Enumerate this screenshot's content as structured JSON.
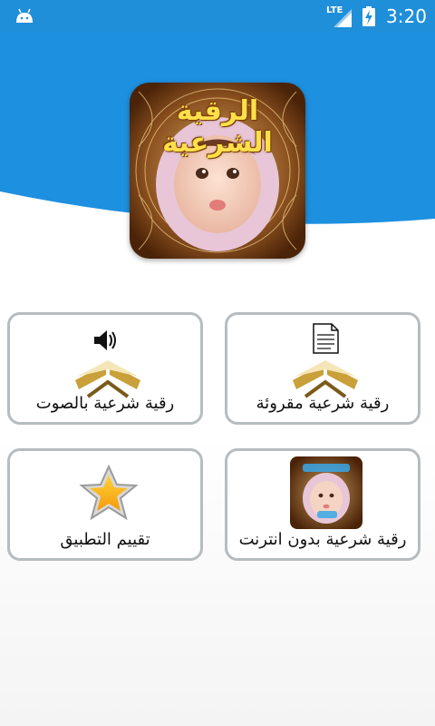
{
  "status_bar": {
    "network": "LTE",
    "time": "3:20"
  },
  "app": {
    "logo_title": "الرقية الشرعية"
  },
  "menu": {
    "written": "رقية شرعية مقروئة",
    "audio": "رقية شرعية بالصوت",
    "offline": "رقية شرعية بدون انترنت",
    "rate": "تقييم التطبيق"
  },
  "icons": {
    "written": "document-quran-icon",
    "audio": "speaker-quran-icon",
    "offline": "baby-ruqyah-thumbnail-icon",
    "rate": "star-icon"
  },
  "colors": {
    "status_bar": "#1f8fd9",
    "header": "#1e90e0",
    "card_border": "#b7bcbf"
  }
}
